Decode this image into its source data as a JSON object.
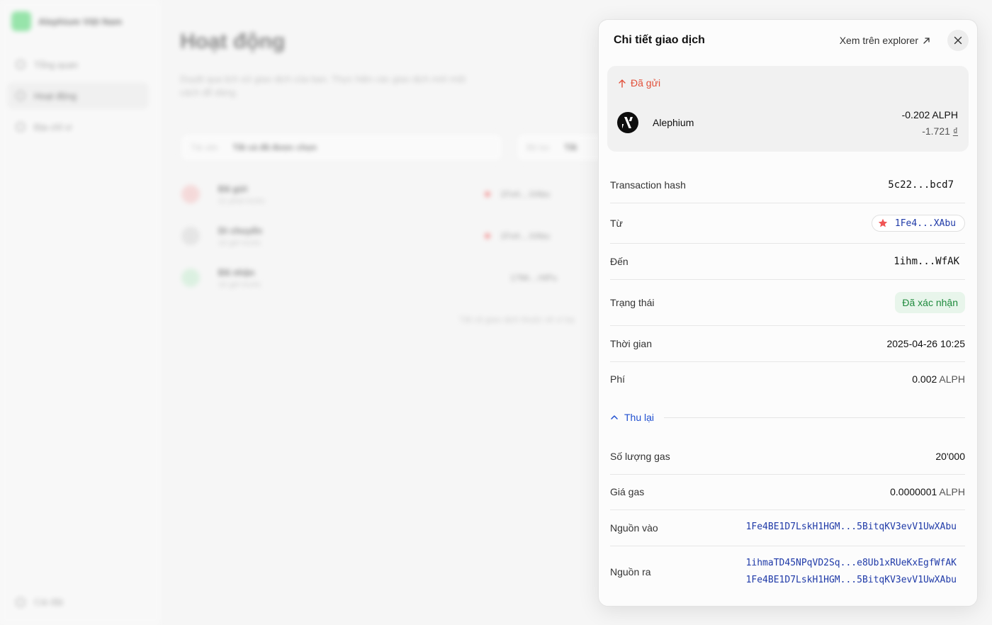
{
  "background": {
    "brand": "Alephium Việt Nam",
    "nav": [
      {
        "label": "Tổng quan"
      },
      {
        "label": "Hoạt động"
      },
      {
        "label": "Địa chỉ ví"
      }
    ],
    "settings": "Cài đặt",
    "page_title": "Hoạt động",
    "page_subtitle": "Duyệt qua lịch sử giao dịch của bạn. Thực hiện các giao dịch mới một cách dễ dàng.",
    "filter_address_label": "Tài sản",
    "filter_address_value": "Tất cả đã được chọn",
    "filter_type_label": "Bộ lọc",
    "filter_type_value": "Tất",
    "transactions": [
      {
        "type": "Đã gửi",
        "time": "21 phút trước",
        "addr": "1Fe4....XAbu",
        "color": "#f4c3c3"
      },
      {
        "type": "Di chuyển",
        "time": "16 giờ trước",
        "addr": "1Fe4....XAbu",
        "color": "#d8d8d8"
      },
      {
        "type": "Đã nhận",
        "time": "16 giờ trước",
        "addr": "17Mr....HiPu",
        "color": "#c6ecd0"
      }
    ],
    "footer_note": "Tất cả giao dịch thuộc về ví bạ"
  },
  "drawer": {
    "title": "Chi tiết giao dịch",
    "explorer_link": "Xem trên explorer",
    "direction": "Đã gửi",
    "token_name": "Alephium",
    "amount": "-0.202 ALPH",
    "fiat_amount": "-1.721",
    "fiat_currency": "₫",
    "rows": {
      "hash_label": "Transaction hash",
      "hash_value": "5c22...bcd7",
      "from_label": "Từ",
      "from_value": "1Fe4...XAbu",
      "to_label": "Đến",
      "to_value": "1ihm...WfAK",
      "status_label": "Trạng thái",
      "status_value": "Đã xác nhận",
      "time_label": "Thời gian",
      "time_value": "2025-04-26 10:25",
      "fee_label": "Phí",
      "fee_value": "0.002",
      "fee_unit": "ALPH"
    },
    "collapse_label": "Thu lại",
    "details": {
      "gas_amount_label": "Số lượng gas",
      "gas_amount_value": "20'000",
      "gas_price_label": "Giá gas",
      "gas_price_value": "0.0000001",
      "gas_price_unit": "ALPH",
      "inputs_label": "Nguồn vào",
      "inputs": [
        "1Fe4BE1D7LskH1HGM...5BitqKV3evV1UwXAbu"
      ],
      "outputs_label": "Nguồn ra",
      "outputs": [
        "1ihmaTD45NPqVD2Sq...e8Ub1xRUeKxEgfWfAK",
        "1Fe4BE1D7LskH1HGM...5BitqKV3evV1UwXAbu"
      ]
    }
  },
  "colors": {
    "sent_red": "#e2503a",
    "link_blue": "#1f4fd0",
    "address_blue": "#1f3aa8",
    "confirmed_green": "#1f8a3d",
    "star_red": "#f05555"
  },
  "icons": [
    "arrow-up-icon",
    "close-icon",
    "external-link-icon",
    "star-icon",
    "chevron-up-icon",
    "alephium-logo-icon"
  ]
}
